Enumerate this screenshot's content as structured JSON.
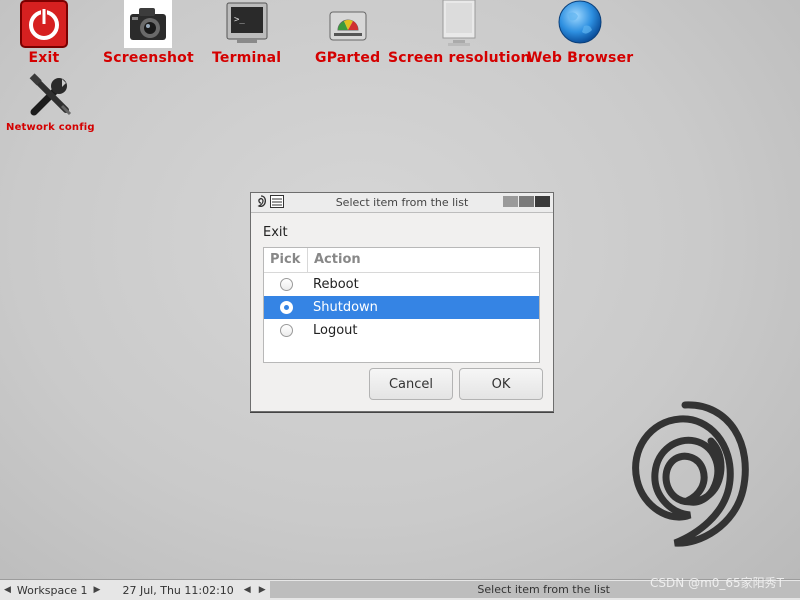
{
  "desktop": {
    "icons": [
      {
        "label": "Exit",
        "icon": "power-icon"
      },
      {
        "label": "Screenshot",
        "icon": "camera-icon"
      },
      {
        "label": "Terminal",
        "icon": "terminal-icon"
      },
      {
        "label": "GParted",
        "icon": "disk-icon"
      },
      {
        "label": "Screen resolution",
        "icon": "monitor-icon"
      },
      {
        "label": "Web Browser",
        "icon": "globe-icon"
      },
      {
        "label": "Network config",
        "icon": "tools-icon"
      }
    ]
  },
  "dialog": {
    "title": "Select item from the list",
    "prompt": "Exit",
    "columns": {
      "pick": "Pick",
      "action": "Action"
    },
    "rows": [
      {
        "action": "Reboot",
        "selected": false
      },
      {
        "action": "Shutdown",
        "selected": true
      },
      {
        "action": "Logout",
        "selected": false
      }
    ],
    "cancel_label": "Cancel",
    "ok_label": "OK"
  },
  "taskbar": {
    "workspace": "Workspace 1",
    "clock": "27 Jul, Thu 11:02:10",
    "task_label": "Select item from the list"
  },
  "watermark": "CSDN @m0_65家阳秀T",
  "colors": {
    "icon_label": "#d40000",
    "selection": "#3584e4",
    "background": "#cacaca"
  }
}
